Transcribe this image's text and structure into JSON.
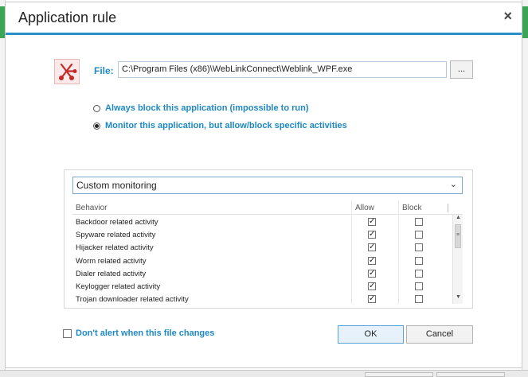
{
  "window": {
    "title": "Application rule",
    "close_glyph": "×"
  },
  "file": {
    "label": "File:",
    "path": "C:\\Program Files (x86)\\WebLinkConnect\\Weblink_WPF.exe",
    "browse_label": "...",
    "icon": "application-icon"
  },
  "options": [
    {
      "label": "Always block this application (impossible to run)",
      "selected": false
    },
    {
      "label": "Monitor this application, but allow/block specific activities",
      "selected": true
    }
  ],
  "monitoring": {
    "selected": "Custom monitoring",
    "columns": {
      "behavior": "Behavior",
      "allow": "Allow",
      "block": "Block"
    },
    "rows": [
      {
        "behavior": "Backdoor related activity",
        "allow": true,
        "block": false
      },
      {
        "behavior": "Spyware related activity",
        "allow": true,
        "block": false
      },
      {
        "behavior": "Hijacker related activity",
        "allow": true,
        "block": false
      },
      {
        "behavior": "Worm related activity",
        "allow": true,
        "block": false
      },
      {
        "behavior": "Dialer related activity",
        "allow": true,
        "block": false
      },
      {
        "behavior": "Keylogger related activity",
        "allow": true,
        "block": false
      },
      {
        "behavior": "Trojan downloader related activity",
        "allow": true,
        "block": false
      }
    ]
  },
  "footer": {
    "dont_alert_label": "Don't alert when this file changes",
    "dont_alert_checked": false,
    "ok_label": "OK",
    "cancel_label": "Cancel"
  },
  "colors": {
    "accent": "#1f88c4",
    "title_rule": "#2b90c7",
    "icon_red": "#c42a2a"
  }
}
